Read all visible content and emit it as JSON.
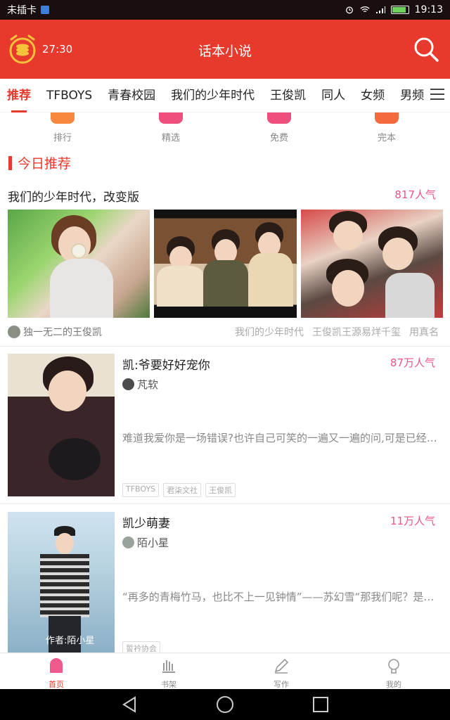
{
  "status_bar": {
    "carrier": "未插卡",
    "time": "19:13"
  },
  "header": {
    "timer": "27:30",
    "title": "话本小说"
  },
  "tabs": [
    {
      "label": "推荐",
      "active": true
    },
    {
      "label": "TFBOYS"
    },
    {
      "label": "青春校园"
    },
    {
      "label": "我们的少年时代"
    },
    {
      "label": "王俊凯"
    },
    {
      "label": "同人"
    },
    {
      "label": "女频"
    },
    {
      "label": "男频"
    }
  ],
  "quick_entries": [
    {
      "label": "排行",
      "color": "#f7883d"
    },
    {
      "label": "精选",
      "color": "#ef4f7c"
    },
    {
      "label": "免费",
      "color": "#ef4f7c"
    },
    {
      "label": "完本",
      "color": "#f46a3d"
    }
  ],
  "section": {
    "title": "今日推荐"
  },
  "featured": {
    "title": "我们的少年时代，改变版",
    "popularity": "817人气",
    "author": "独一无二的王俊凯",
    "tags": [
      "我们的少年时代",
      "王俊凯王源易烊千玺",
      "用真名"
    ]
  },
  "books": [
    {
      "title": "凯:爷要好好宠你",
      "popularity": "87万人气",
      "author": "芃软",
      "description": "难道我爱你是一场错误?也许自己可笑的一遍又一遍的问,可是已经晚了...",
      "tags": [
        "TFBOYS",
        "君柒文社",
        "王俊凯"
      ]
    },
    {
      "title": "凯少萌妻",
      "popularity": "11万人气",
      "author": "陌小星",
      "description": "“再多的青梅竹马，也比不上一见钟情”——苏幻雪“那我们呢？是青梅竹马...",
      "tags": [
        "誓衿协会"
      ],
      "cover_text": "作者:陌小星"
    }
  ],
  "bottom_nav": [
    {
      "label": "首页",
      "active": true
    },
    {
      "label": "书架"
    },
    {
      "label": "写作"
    },
    {
      "label": "我的"
    }
  ],
  "colors": {
    "primary": "#e8392d",
    "popularity": "#ec5486"
  }
}
